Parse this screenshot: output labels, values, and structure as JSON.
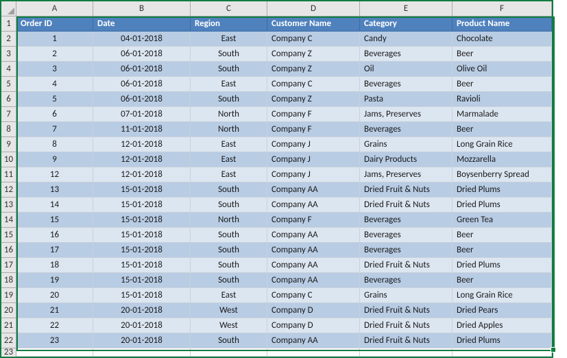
{
  "columns": [
    "A",
    "B",
    "C",
    "D",
    "E",
    "F"
  ],
  "rownums": [
    1,
    2,
    3,
    4,
    5,
    6,
    7,
    8,
    9,
    10,
    11,
    12,
    13,
    14,
    15,
    16,
    17,
    18,
    19,
    20,
    21,
    22,
    23
  ],
  "headers": {
    "A": "Order ID",
    "B": "Date",
    "C": "Region",
    "D": "Customer Name",
    "E": "Category",
    "F": "Product Name"
  },
  "chart_data": {
    "type": "table",
    "columns": [
      "Order ID",
      "Date",
      "Region",
      "Customer Name",
      "Category",
      "Product Name"
    ],
    "rows": [
      [
        1,
        "04-01-2018",
        "East",
        "Company C",
        "Candy",
        "Chocolate"
      ],
      [
        2,
        "06-01-2018",
        "South",
        "Company Z",
        "Beverages",
        "Beer"
      ],
      [
        3,
        "06-01-2018",
        "South",
        "Company Z",
        "Oil",
        "Olive Oil"
      ],
      [
        4,
        "06-01-2018",
        "East",
        "Company C",
        "Beverages",
        "Beer"
      ],
      [
        5,
        "06-01-2018",
        "South",
        "Company Z",
        "Pasta",
        "Ravioli"
      ],
      [
        6,
        "07-01-2018",
        "North",
        "Company F",
        "Jams, Preserves",
        "Marmalade"
      ],
      [
        7,
        "11-01-2018",
        "North",
        "Company F",
        "Beverages",
        "Beer"
      ],
      [
        8,
        "12-01-2018",
        "East",
        "Company J",
        "Grains",
        "Long Grain Rice"
      ],
      [
        9,
        "12-01-2018",
        "East",
        "Company J",
        "Dairy Products",
        "Mozzarella"
      ],
      [
        12,
        "12-01-2018",
        "East",
        "Company J",
        "Jams, Preserves",
        "Boysenberry Spread"
      ],
      [
        13,
        "15-01-2018",
        "South",
        "Company AA",
        "Dried Fruit & Nuts",
        "Dried Plums"
      ],
      [
        14,
        "15-01-2018",
        "South",
        "Company AA",
        "Dried Fruit & Nuts",
        "Dried Plums"
      ],
      [
        15,
        "15-01-2018",
        "North",
        "Company F",
        "Beverages",
        "Green Tea"
      ],
      [
        16,
        "15-01-2018",
        "South",
        "Company AA",
        "Beverages",
        "Beer"
      ],
      [
        17,
        "15-01-2018",
        "South",
        "Company AA",
        "Beverages",
        "Beer"
      ],
      [
        18,
        "15-01-2018",
        "South",
        "Company AA",
        "Dried Fruit & Nuts",
        "Dried Plums"
      ],
      [
        19,
        "15-01-2018",
        "South",
        "Company AA",
        "Beverages",
        "Beer"
      ],
      [
        20,
        "15-01-2018",
        "East",
        "Company C",
        "Grains",
        "Long Grain Rice"
      ],
      [
        21,
        "20-01-2018",
        "West",
        "Company D",
        "Dried Fruit & Nuts",
        "Dried Pears"
      ],
      [
        22,
        "20-01-2018",
        "West",
        "Company D",
        "Dried Fruit & Nuts",
        "Dried Apples"
      ],
      [
        23,
        "20-01-2018",
        "South",
        "Company AA",
        "Dried Fruit & Nuts",
        "Dried Plums"
      ]
    ]
  }
}
